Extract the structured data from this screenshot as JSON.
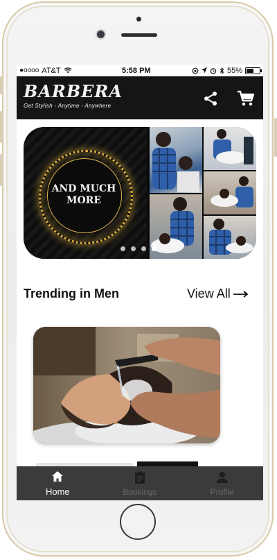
{
  "status_bar": {
    "carrier": "AT&T",
    "signal_dots": "●oooo",
    "time": "5:58 PM",
    "battery": "55%",
    "battery_level": 0.55
  },
  "app_bar": {
    "logo_name": "BARBERA",
    "logo_tagline": "Get Stylish - Anytime - Anywhere",
    "icons": [
      "share-icon",
      "cart-icon"
    ]
  },
  "banner": {
    "text_line1": "AND MUCH",
    "text_line2": "MORE",
    "slide_count": 4,
    "active_slide": 4
  },
  "section": {
    "title": "Trending in Men",
    "view_all": "View All"
  },
  "bottom_nav": {
    "items": [
      {
        "label": "Home",
        "icon": "home-icon",
        "active": true
      },
      {
        "label": "Bookings",
        "icon": "clipboard-icon",
        "active": false
      },
      {
        "label": "Profile",
        "icon": "person-icon",
        "active": false
      }
    ]
  },
  "colors": {
    "app_bar": "#151515",
    "bottom_nav": "#3b3b3b",
    "gold_accent": "#d7a93a"
  }
}
